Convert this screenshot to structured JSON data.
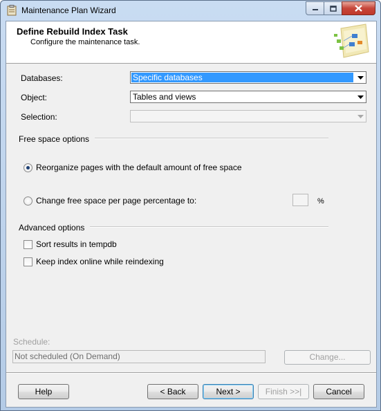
{
  "window": {
    "title": "Maintenance Plan Wizard"
  },
  "header": {
    "title": "Define Rebuild Index Task",
    "subtitle": "Configure the maintenance task."
  },
  "form": {
    "databases_label": "Databases:",
    "databases_value": "Specific databases",
    "object_label": "Object:",
    "object_value": "Tables and views",
    "selection_label": "Selection:",
    "selection_value": ""
  },
  "free_space": {
    "group_label": "Free space options",
    "option1_label": "Reorganize pages with the default amount of free space",
    "option1_checked": true,
    "option2_label": "Change free space per page percentage to:",
    "option2_checked": false,
    "percent_value": "",
    "percent_suffix": "%"
  },
  "advanced": {
    "group_label": "Advanced options",
    "sort_label": "Sort results in tempdb",
    "sort_checked": false,
    "online_label": "Keep index online while reindexing",
    "online_checked": false
  },
  "schedule": {
    "label": "Schedule:",
    "value": "Not scheduled (On Demand)",
    "change_label": "Change..."
  },
  "buttons": {
    "help": "Help",
    "back": "< Back",
    "next": "Next >",
    "finish": "Finish >>|",
    "cancel": "Cancel"
  },
  "colors": {
    "selection": "#3399ff",
    "window_frame": "#b4cbe6",
    "close_button": "#c6463a"
  }
}
